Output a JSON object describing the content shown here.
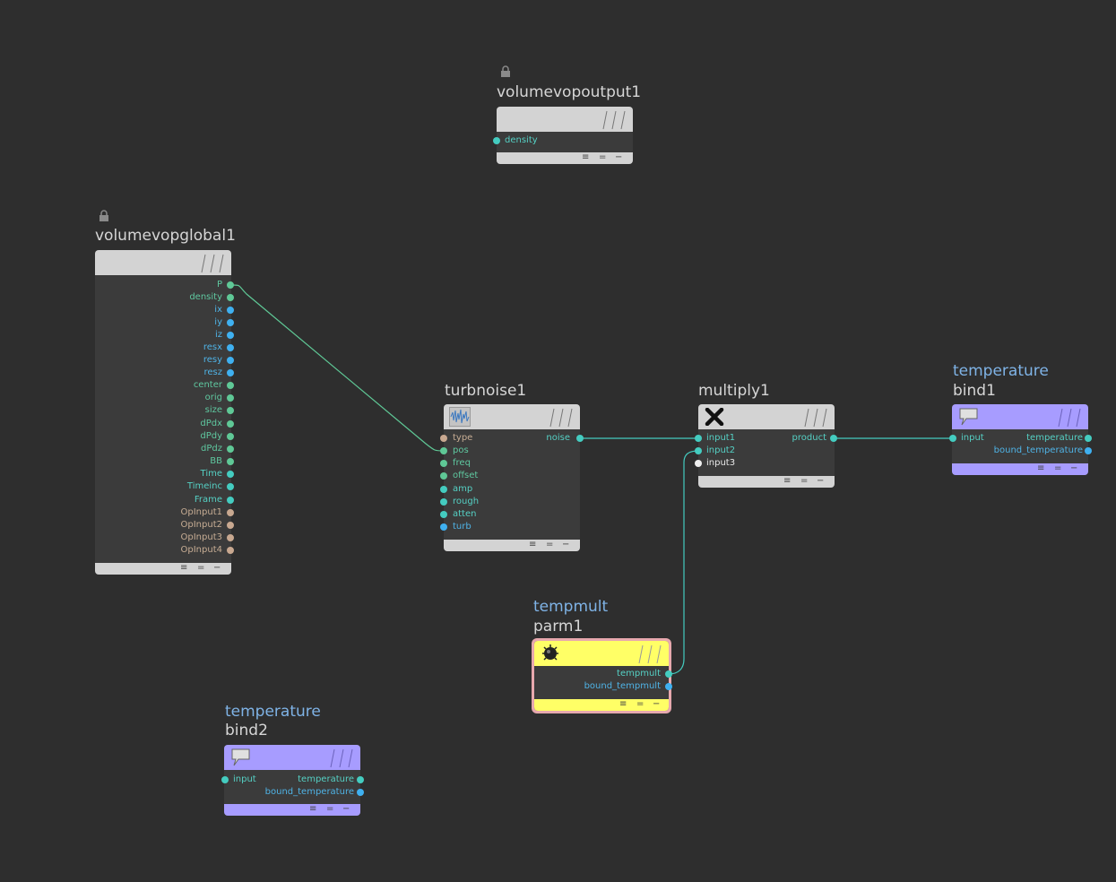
{
  "colors": {
    "background": "#2e2e2e",
    "node_header_gray": "#d3d3d3",
    "bind_purple": "#a79cff",
    "parm_yellow": "#ffff66",
    "parm_border": "#e7a8ae",
    "wire_green": "#5fc896",
    "wire_teal": "#44ccc0"
  },
  "nodes": {
    "volumevopoutput1": {
      "title": "volumevopoutput1",
      "icon": "lock-icon",
      "inputs": [
        "density"
      ]
    },
    "volumevopglobal1": {
      "title": "volumevopglobal1",
      "icon": "lock-icon",
      "outputs": [
        "P",
        "density",
        "ix",
        "iy",
        "iz",
        "resx",
        "resy",
        "resz",
        "center",
        "orig",
        "size",
        "dPdx",
        "dPdy",
        "dPdz",
        "BB",
        "Time",
        "Timeinc",
        "Frame",
        "OpInput1",
        "OpInput2",
        "OpInput3",
        "OpInput4"
      ]
    },
    "turbnoise1": {
      "title": "turbnoise1",
      "icon": "noise-icon",
      "inputs": [
        "type",
        "pos",
        "freq",
        "offset",
        "amp",
        "rough",
        "atten",
        "turb"
      ],
      "outputs": [
        "noise"
      ]
    },
    "multiply1": {
      "title": "multiply1",
      "icon": "multiply-x-icon",
      "inputs": [
        "input1",
        "input2",
        "input3"
      ],
      "outputs": [
        "product"
      ]
    },
    "bind1": {
      "subtitle": "temperature",
      "title": "bind1",
      "icon": "speech-bubble-icon",
      "inputs": [
        "input"
      ],
      "outputs": [
        "temperature",
        "bound_temperature"
      ]
    },
    "parm1": {
      "subtitle": "tempmult",
      "title": "parm1",
      "icon": "knob-icon",
      "outputs": [
        "tempmult",
        "bound_tempmult"
      ]
    },
    "bind2": {
      "subtitle": "temperature",
      "title": "bind2",
      "icon": "speech-bubble-icon",
      "inputs": [
        "input"
      ],
      "outputs": [
        "temperature",
        "bound_temperature"
      ]
    }
  },
  "footer_glyphs": [
    "≡",
    "=",
    "−"
  ]
}
